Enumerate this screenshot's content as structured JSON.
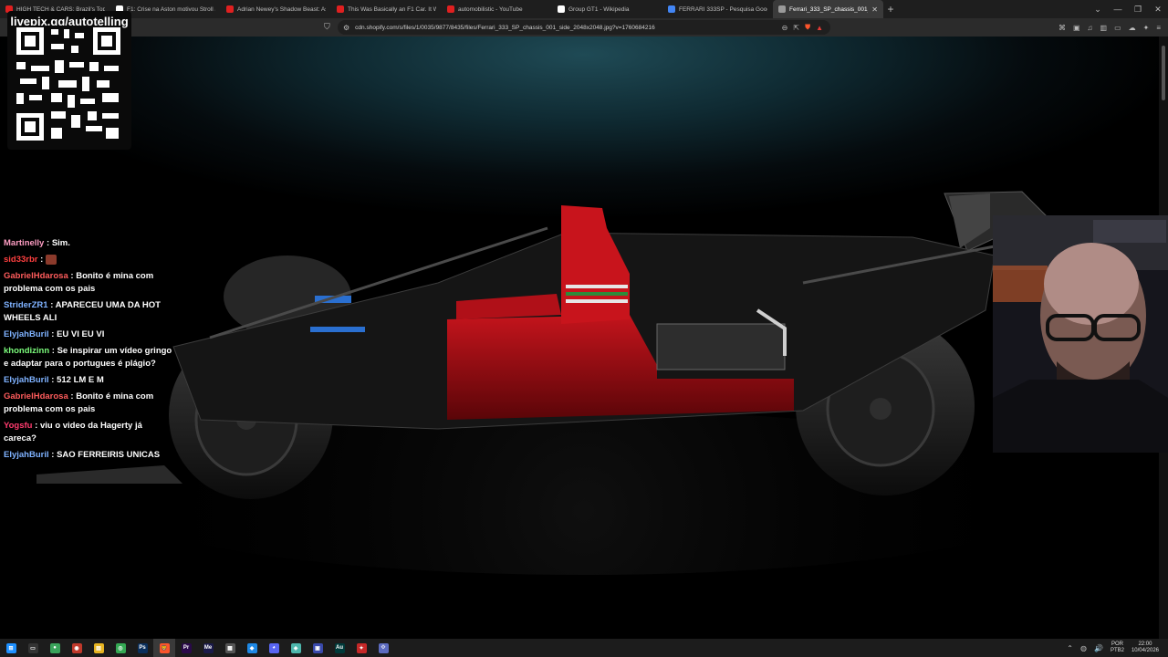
{
  "browser": {
    "tabs": [
      {
        "title": "HIGH TECH & CARS: Brazil's Top Car...",
        "favicon_color": "#e02020",
        "active": false
      },
      {
        "title": "F1: Crise na Aston motivou Stroll a ...",
        "favicon_color": "#ffffff",
        "active": false
      },
      {
        "title": "Adrian Newey's Shadow Beast: Aston...",
        "favicon_color": "#e02020",
        "active": false
      },
      {
        "title": "This Was Basically an F1 Car. It Won ...",
        "favicon_color": "#e02020",
        "active": false
      },
      {
        "title": "automobilistic - YouTube",
        "favicon_color": "#e02020",
        "active": false
      },
      {
        "title": "Group GT1 - Wikipedia",
        "favicon_color": "#ffffff",
        "active": false
      },
      {
        "title": "FERRARI 333SP - Pesquisa Google",
        "favicon_color": "#4285f4",
        "active": false
      },
      {
        "title": "Ferrari_333_SP_chassis_001_side...",
        "favicon_color": "#9a9a9a",
        "active": true
      }
    ],
    "url": "cdn.shopify.com/s/files/1/0035/9877/8435/files/Ferrari_333_SP_chassis_001_side_2048x2048.jpg?v=1760684216"
  },
  "overlay": {
    "qr_title": "livepix.gg/autotelling"
  },
  "chat": [
    {
      "user": "Martinelly",
      "color": "#ff9ec4",
      "text": "Sim."
    },
    {
      "user": "sid33rbr",
      "color": "#ff4040",
      "text": "",
      "emote": true
    },
    {
      "user": "GabrielHdarosa",
      "color": "#ff5c5c",
      "text": "Bonito é mina com problema com os pais"
    },
    {
      "user": "StriderZR1",
      "color": "#7fb2ff",
      "text": "APARECEU UMA DA HOT WHEELS ALI"
    },
    {
      "user": "ElyjahBuril",
      "color": "#7fb2ff",
      "text": "EU VI EU VI"
    },
    {
      "user": "khondizinn",
      "color": "#7cfc7c",
      "text": "Se inspirar um vídeo gringo e adaptar para o portugues é plágio?"
    },
    {
      "user": "ElyjahBuril",
      "color": "#7fb2ff",
      "text": "512 LM E M"
    },
    {
      "user": "GabrielHdarosa",
      "color": "#ff5c5c",
      "text": "Bonito é mina com problema com os pais"
    },
    {
      "user": "Yogsfu",
      "color": "#ff3b6e",
      "text": "viu o video da Hagerty já careca?"
    },
    {
      "user": "ElyjahBuril",
      "color": "#7fb2ff",
      "text": "SAO FERREIRIS UNICAS"
    }
  ],
  "taskbar": {
    "apps": [
      {
        "name": "start",
        "color": "#1e90ff",
        "label": "⊞"
      },
      {
        "name": "task-view",
        "color": "#333",
        "label": "▭"
      },
      {
        "name": "app-1",
        "color": "#3aa35b",
        "label": "●"
      },
      {
        "name": "app-2",
        "color": "#c0392b",
        "label": "◉"
      },
      {
        "name": "file-explorer",
        "color": "#e6b422",
        "label": "▤"
      },
      {
        "name": "chrome",
        "color": "#34a853",
        "label": "◎"
      },
      {
        "name": "photoshop",
        "color": "#0a2f5c",
        "label": "Ps"
      },
      {
        "name": "brave",
        "color": "#fb542b",
        "label": "🦁"
      },
      {
        "name": "premiere",
        "color": "#2a0a4a",
        "label": "Pr"
      },
      {
        "name": "media-encoder",
        "color": "#1a1a4a",
        "label": "Me"
      },
      {
        "name": "calculator",
        "color": "#555",
        "label": "▦"
      },
      {
        "name": "app-3",
        "color": "#1e88e5",
        "label": "◆"
      },
      {
        "name": "discord",
        "color": "#5865f2",
        "label": "◕"
      },
      {
        "name": "app-4",
        "color": "#4db6ac",
        "label": "◈"
      },
      {
        "name": "app-5",
        "color": "#3949ab",
        "label": "▣"
      },
      {
        "name": "audition",
        "color": "#003a3a",
        "label": "Au"
      },
      {
        "name": "app-6",
        "color": "#c62828",
        "label": "✦"
      },
      {
        "name": "app-7",
        "color": "#5c6bc0",
        "label": "⟐"
      }
    ],
    "tray": {
      "lang": "POR",
      "layout": "PTB2",
      "time": "22:00",
      "date": "10/04/2026"
    }
  }
}
